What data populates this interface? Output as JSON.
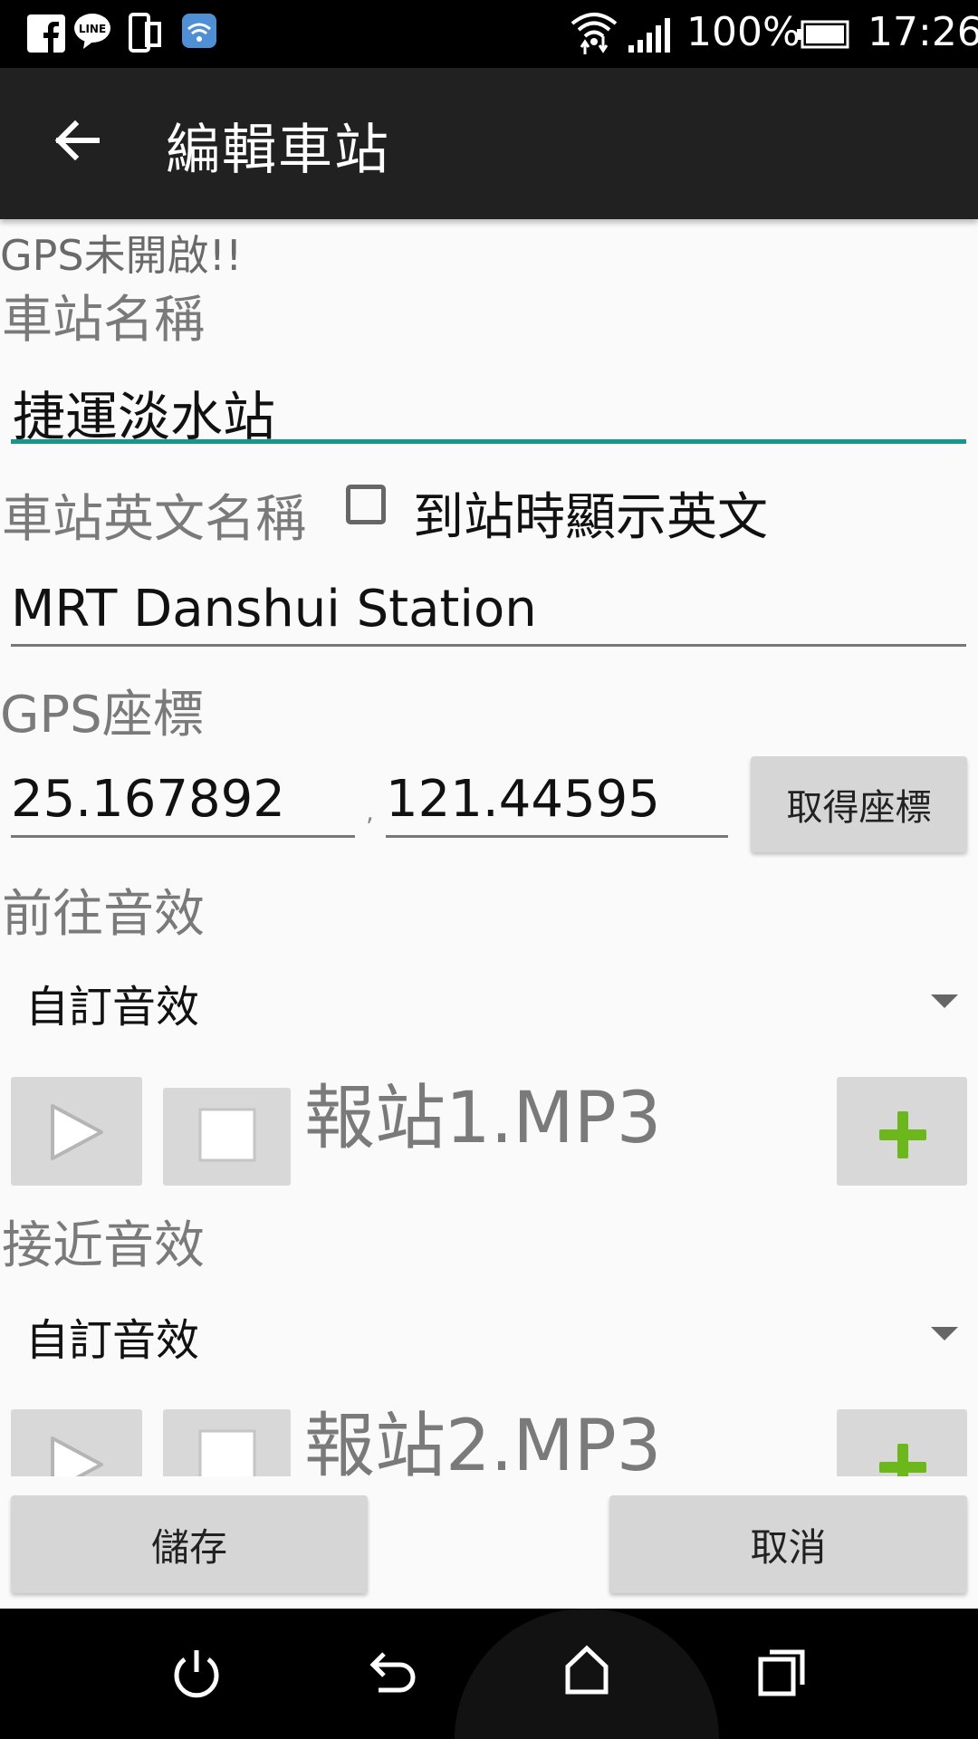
{
  "status_bar": {
    "battery": "100%",
    "time": "17:26",
    "icons": [
      "facebook-icon",
      "line-icon",
      "device-icon",
      "wifi-app-icon",
      "wifi-icon",
      "signal-icon",
      "battery-icon"
    ]
  },
  "app_bar": {
    "title": "編輯車站",
    "back_icon": "arrow-back-icon"
  },
  "gps_warning": "GPS未開啟!!",
  "station_name": {
    "label": "車站名稱",
    "value": "捷運淡水站"
  },
  "station_english": {
    "label": "車站英文名稱",
    "checkbox_label": "到站時顯示英文",
    "checkbox_checked": false,
    "value": "MRT Danshui Station"
  },
  "gps": {
    "label": "GPS座標",
    "latitude": "25.167892",
    "separator": ",",
    "longitude": "121.44595",
    "get_button": "取得座標"
  },
  "departure_sound": {
    "label": "前往音效",
    "selected": "自訂音效",
    "file": "報站1.MP3"
  },
  "approach_sound": {
    "label": "接近音效",
    "selected": "自訂音效",
    "file": "報站2.MP3"
  },
  "footer": {
    "save": "儲存",
    "cancel": "取消"
  },
  "colors": {
    "accent": "#17968a",
    "add_icon": "#6cb81c",
    "app_bar": "#212121"
  }
}
